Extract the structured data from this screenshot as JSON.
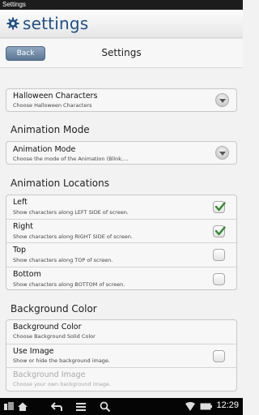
{
  "window": {
    "title": "Settings"
  },
  "appbar": {
    "title": "settings"
  },
  "header": {
    "back_label": "Back",
    "title": "Settings"
  },
  "characters": {
    "title": "Halloween Characters",
    "subtitle": "Choose Halloween Characters"
  },
  "animation_mode": {
    "section": "Animation Mode",
    "title": "Animation Mode",
    "subtitle": "Choose the mode of the Animation (Blink,..."
  },
  "locations": {
    "section": "Animation Locations",
    "items": [
      {
        "title": "Left",
        "subtitle": "Show characters along LEFT SIDE of screen.",
        "checked": true
      },
      {
        "title": "Right",
        "subtitle": "Show characters along RIGHT SIDE of screen.",
        "checked": true
      },
      {
        "title": "Top",
        "subtitle": "Show characters along TOP of screen.",
        "checked": false
      },
      {
        "title": "Bottom",
        "subtitle": "Show characters along BOTTOM of screen.",
        "checked": false
      }
    ]
  },
  "background": {
    "section": "Background Color",
    "color": {
      "title": "Background Color",
      "subtitle": "Choose Background Solid Color"
    },
    "use_image": {
      "title": "Use Image",
      "subtitle": "Show or hide the background image.",
      "checked": false
    },
    "image": {
      "title": "Background Image",
      "subtitle": "Choose your own background image.",
      "enabled": false
    }
  },
  "statusbar": {
    "time": "12:29"
  },
  "colors": {
    "accent": "#1f4f86",
    "check": "#2e8b2e",
    "button": "#6b85a3"
  }
}
